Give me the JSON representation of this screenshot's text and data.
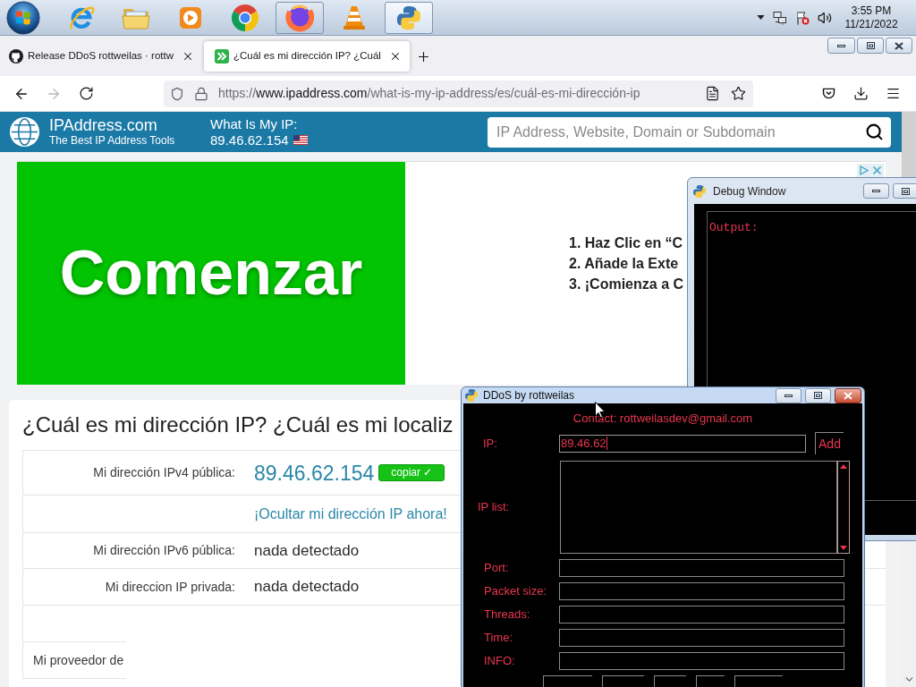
{
  "taskbar": {
    "apps": [
      {
        "kind": "orbit",
        "running": false,
        "selected": false
      },
      {
        "kind": "folder",
        "running": false,
        "selected": false
      },
      {
        "kind": "media",
        "running": false,
        "selected": false
      },
      {
        "kind": "tricolor",
        "running": false,
        "selected": false
      },
      {
        "kind": "swirl",
        "running": true,
        "selected": false
      },
      {
        "kind": "cone",
        "running": false,
        "selected": false
      },
      {
        "kind": "snake",
        "running": true,
        "selected": true
      }
    ],
    "clock": {
      "time": "3:55 PM",
      "date": "11/21/2022"
    }
  },
  "browser": {
    "tabs": [
      {
        "kind": "cat",
        "title": "Release DDoS rottweilas · rottw",
        "selected": false
      },
      {
        "kind": "chevrons",
        "title": "¿Cuál es mi dirección IP? ¿Cuál",
        "selected": true
      }
    ],
    "nav": {
      "forward_disabled": true
    },
    "url": {
      "scheme": "https://",
      "host": "www.ipaddress.com",
      "path": "/what-is-my-ip-address/es/cuál-es-mi-dirección-ip"
    }
  },
  "page": {
    "header": {
      "site_name": "IPAddress.com",
      "tagline": "The Best IP Address Tools",
      "my_ip_label": "What Is My IP:",
      "my_ip": "89.46.62.154",
      "search": {
        "placeholder": "IP Address, Website, Domain or Subdomain"
      }
    },
    "ad": {
      "button": "Comenzar",
      "steps": [
        "1. Haz Clic en “C",
        "2. Añade la Exte",
        "3. ¡Comienza a C"
      ]
    },
    "article": {
      "title": "¿Cuál es mi dirección IP? ¿Cuál es mi localiz",
      "rows": [
        {
          "kind": "ip",
          "label": "Mi dirección IPv4 pública:",
          "value": "89.46.62.154",
          "button": "copiar ✓"
        },
        {
          "kind": "link",
          "value": "¡Ocultar mi dirección IP ahora!"
        },
        {
          "kind": "text",
          "label": "Mi dirección IPv6 pública:",
          "value": "nada detectado"
        },
        {
          "kind": "text",
          "label": "Mi direccion IP privada:",
          "value": "nada detectado"
        },
        {
          "kind": "stub"
        },
        {
          "kind": "stub",
          "label": "Mi proveedor de"
        }
      ]
    }
  },
  "debug_window": {
    "title": "Debug Window",
    "active": false,
    "output_label": "Output:"
  },
  "ddos_window": {
    "title": "DDoS by rottweilas",
    "active": true,
    "contact": "Contact: rottweilasdev@gmail.com",
    "ip": {
      "label": "IP:",
      "value": "89.46.62",
      "focused": true
    },
    "add_button": "Add",
    "ip_list_label": "IP list:",
    "fields": [
      {
        "label": "Port:"
      },
      {
        "label": "Packet size:"
      },
      {
        "label": "Threads:"
      },
      {
        "label": "Time:"
      },
      {
        "label": "INFO:"
      }
    ]
  }
}
